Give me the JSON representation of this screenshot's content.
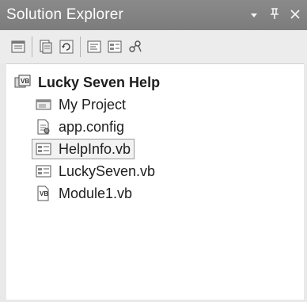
{
  "panel": {
    "title": "Solution Explorer",
    "dropdown_glyph": "▾",
    "pin_glyph": "ᵖ",
    "close_glyph": "×"
  },
  "toolbar": {
    "buttons": [
      "properties-icon",
      "show-all-files-icon",
      "refresh-icon",
      "view-code-icon",
      "view-designer-icon",
      "class-diagram-icon"
    ]
  },
  "tree": {
    "root": {
      "label": "Lucky Seven Help",
      "icon": "vb-project-icon"
    },
    "items": [
      {
        "label": "My Project",
        "icon": "my-project-icon"
      },
      {
        "label": "app.config",
        "icon": "config-file-icon"
      },
      {
        "label": "HelpInfo.vb",
        "icon": "form-file-icon",
        "selected": true
      },
      {
        "label": "LuckySeven.vb",
        "icon": "form-file-icon"
      },
      {
        "label": "Module1.vb",
        "icon": "module-file-icon"
      }
    ]
  }
}
